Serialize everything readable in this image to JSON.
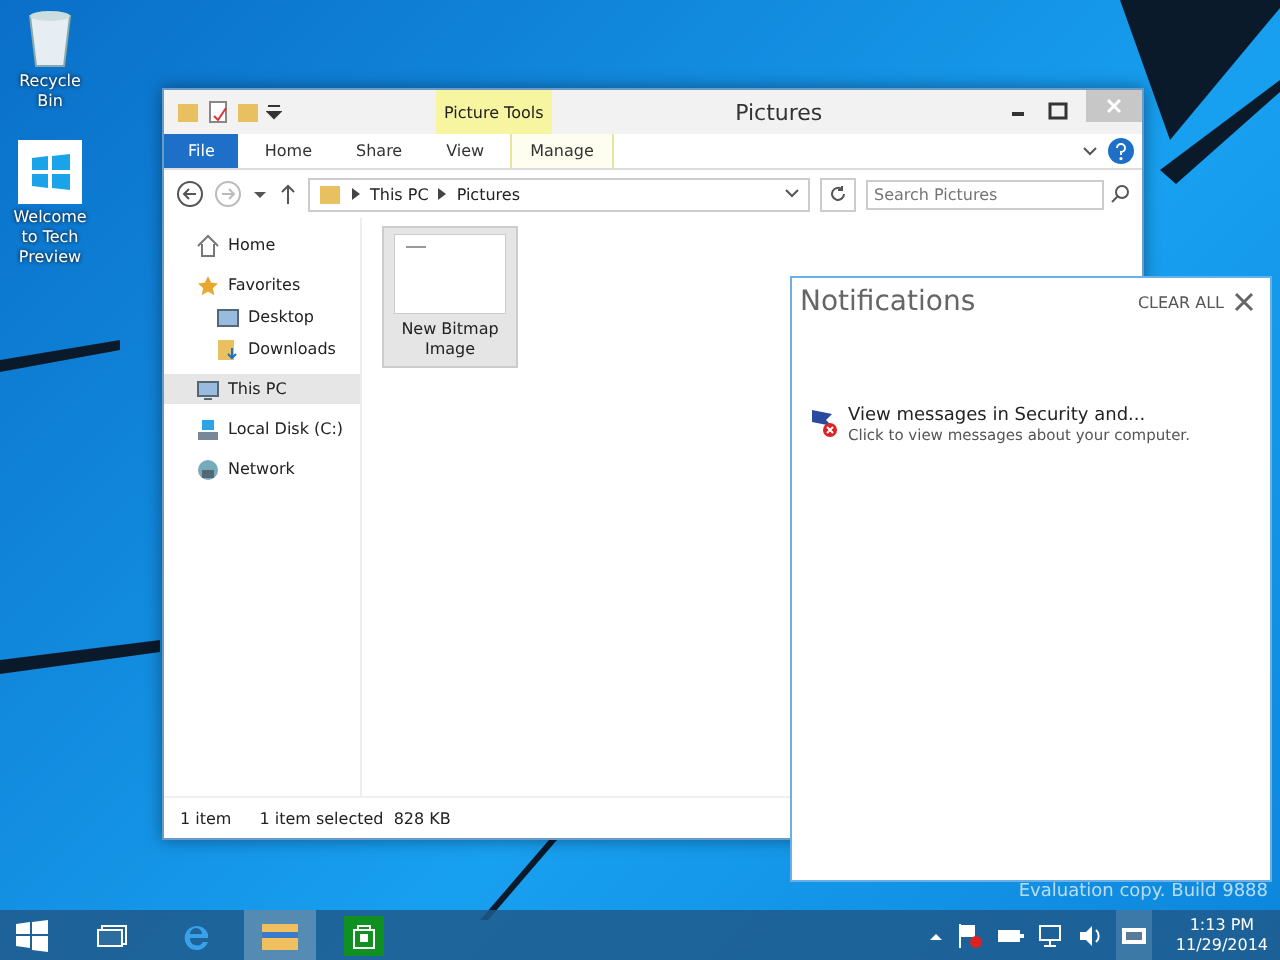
{
  "desktop_icons": [
    {
      "label": "Recycle Bin",
      "kind": "bin"
    },
    {
      "label": "Welcome to Tech Preview",
      "kind": "windows"
    }
  ],
  "window": {
    "title": "Pictures",
    "context_tab_group": "Picture Tools",
    "ribbon_tabs": [
      {
        "label": "File",
        "selected": true
      },
      {
        "label": "Home",
        "selected": false
      },
      {
        "label": "Share",
        "selected": false
      },
      {
        "label": "View",
        "selected": false
      },
      {
        "label": "Manage",
        "selected": false
      }
    ],
    "breadcrumb": [
      "This PC",
      "Pictures"
    ],
    "search": {
      "placeholder": "Search Pictures"
    },
    "nav_items": [
      {
        "label": "Home",
        "kind": "home",
        "selected": false
      },
      {
        "label": "Favorites",
        "kind": "star",
        "selected": false,
        "children": [
          {
            "label": "Desktop",
            "kind": "desktop",
            "selected": false
          },
          {
            "label": "Downloads",
            "kind": "downloads",
            "selected": false
          }
        ]
      },
      {
        "label": "This PC",
        "kind": "pc",
        "selected": true
      },
      {
        "label": "Local Disk (C:)",
        "kind": "disk",
        "selected": false
      },
      {
        "label": "Network",
        "kind": "network",
        "selected": false
      }
    ],
    "files": [
      {
        "name": "New Bitmap Image",
        "selected": true
      }
    ],
    "status_bar": [
      "1 item",
      "1 item selected  828 KB"
    ]
  },
  "notifications": {
    "title": "Notifications",
    "clear_all": "CLEAR ALL",
    "items": [
      {
        "title": "View messages in Security and...",
        "body": "Click to view messages about your computer."
      }
    ]
  },
  "watermark": "Evaluation copy. Build 9888",
  "taskbar": {
    "apps": [
      {
        "kind": "ie",
        "active": false
      },
      {
        "kind": "explorer",
        "active": true
      },
      {
        "kind": "store",
        "active": false
      }
    ],
    "time": "1:13 PM",
    "date": "11/29/2014"
  }
}
